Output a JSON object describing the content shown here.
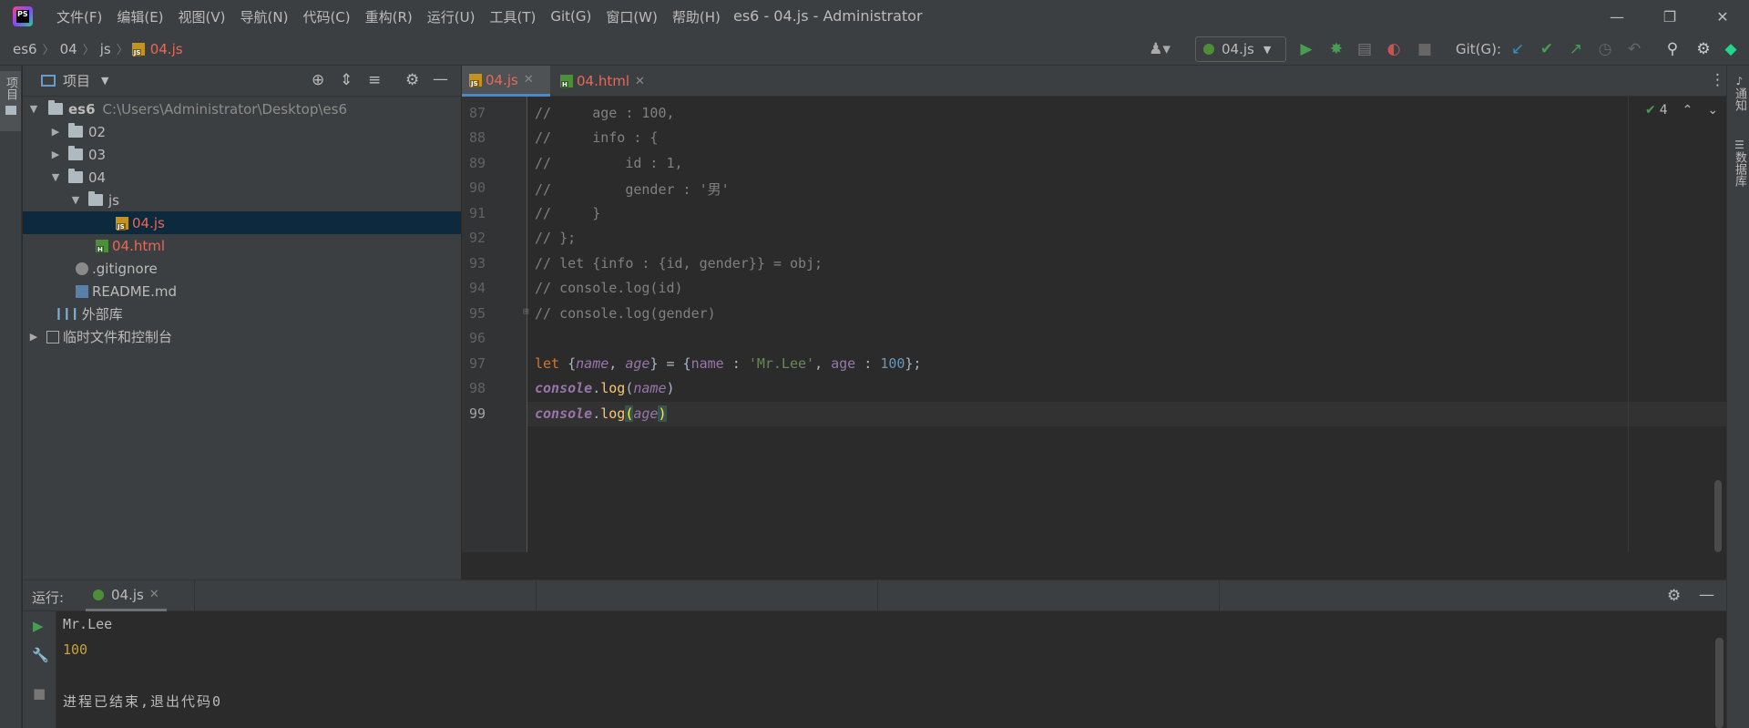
{
  "app": {
    "window_title": "es6 - 04.js - Administrator",
    "logo_text": "PS",
    "menu": [
      "文件(F)",
      "编辑(E)",
      "视图(V)",
      "导航(N)",
      "代码(C)",
      "重构(R)",
      "运行(U)",
      "工具(T)",
      "Git(G)",
      "窗口(W)",
      "帮助(H)"
    ]
  },
  "navbar": {
    "breadcrumbs": [
      "es6",
      "04",
      "js",
      "04.js"
    ],
    "run_config": "04.js",
    "git_label": "Git(G):"
  },
  "left_strip": {
    "project_label": "项目"
  },
  "right_strip": {
    "notifications_label": "通知",
    "database_label": "数据库"
  },
  "project": {
    "title": "项目",
    "tree": [
      {
        "label": "es6",
        "path": "C:\\Users\\Administrator\\Desktop\\es6"
      },
      {
        "label": "02"
      },
      {
        "label": "03"
      },
      {
        "label": "04"
      },
      {
        "label": "js"
      },
      {
        "label": "04.js"
      },
      {
        "label": "04.html"
      },
      {
        "label": ".gitignore"
      },
      {
        "label": "README.md"
      },
      {
        "label": "外部库"
      },
      {
        "label": "临时文件和控制台"
      }
    ]
  },
  "tabs": [
    {
      "label": "04.js",
      "active": true
    },
    {
      "label": "04.html",
      "active": false
    }
  ],
  "editor": {
    "inspection_count": "4",
    "line_numbers": [
      "87",
      "88",
      "89",
      "90",
      "91",
      "92",
      "93",
      "94",
      "95",
      "96",
      "97",
      "98",
      "99"
    ],
    "lines": {
      "l87": "//     age : 100,",
      "l88": "//     info : {",
      "l89": "//         id : 1,",
      "l90": "//         gender : '男'",
      "l91": "//     }",
      "l92": "// };",
      "l93": "// let {info : {id, gender}} = obj;",
      "l94": "// console.log(id)",
      "l95": "// console.log(gender)",
      "l97": {
        "kw": "let",
        "b1": " {",
        "p1": "name",
        "c1": ", ",
        "p2": "age",
        "b2": "} = {",
        "p3": "name",
        "c2": " : ",
        "s1": "'Mr.Lee'",
        "c3": ", ",
        "p4": "age",
        "c4": " : ",
        "n1": "100",
        "end": "};"
      },
      "l98": {
        "obj": "console",
        "dot": ".",
        "fn": "log",
        "open": "(",
        "arg": "name",
        "close": ")"
      },
      "l99": {
        "obj": "console",
        "dot": ".",
        "fn": "log",
        "open": "(",
        "arg": "age",
        "close": ")"
      }
    }
  },
  "run": {
    "label": "运行:",
    "tab": "04.js",
    "output": [
      "Mr.Lee",
      "100",
      "",
      "进程已结束,退出代码0"
    ]
  }
}
